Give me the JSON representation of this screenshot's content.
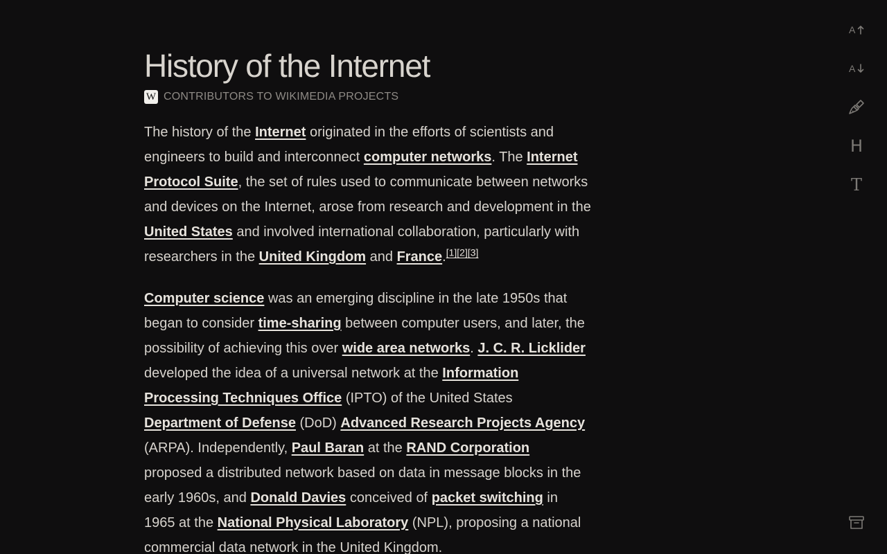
{
  "article": {
    "title": "History of the Internet",
    "source_logo": "W",
    "byline": "CONTRIBUTORS TO WIKIMEDIA PROJECTS",
    "p1": [
      {
        "t": "The history of the "
      },
      {
        "t": "Internet",
        "link": true
      },
      {
        "t": " originated in the efforts of scientists and engineers to build and interconnect "
      },
      {
        "t": "computer networks",
        "link": true
      },
      {
        "t": ". The "
      },
      {
        "t": "Internet Protocol Suite",
        "link": true
      },
      {
        "t": ", the set of rules used to communicate between networks and devices on the Internet, arose from research and development in the "
      },
      {
        "t": "United States",
        "link": true
      },
      {
        "t": " and involved international collaboration, particularly with researchers in the "
      },
      {
        "t": "United Kingdom",
        "link": true
      },
      {
        "t": " and "
      },
      {
        "t": "France",
        "link": true
      },
      {
        "t": "."
      },
      {
        "t": "[1]",
        "link": true,
        "sup": true
      },
      {
        "t": "[2]",
        "link": true,
        "sup": true
      },
      {
        "t": "[3]",
        "link": true,
        "sup": true
      }
    ],
    "p2": [
      {
        "t": "Computer science",
        "link": true
      },
      {
        "t": " was an emerging discipline in the late 1950s that began to consider "
      },
      {
        "t": "time-sharing",
        "link": true
      },
      {
        "t": " between computer users, and later, the possibility of achieving this over "
      },
      {
        "t": "wide area networks",
        "link": true
      },
      {
        "t": ". "
      },
      {
        "t": "J. C. R. Licklider",
        "link": true
      },
      {
        "t": " developed the idea of a universal network at the "
      },
      {
        "t": "Information Processing Techniques Office",
        "link": true
      },
      {
        "t": " (IPTO) of the United States "
      },
      {
        "t": "Department of Defense",
        "link": true
      },
      {
        "t": " (DoD) "
      },
      {
        "t": "Advanced Research Projects Agency",
        "link": true
      },
      {
        "t": " (ARPA). Independently, "
      },
      {
        "t": "Paul Baran",
        "link": true
      },
      {
        "t": " at the "
      },
      {
        "t": "RAND Corporation",
        "link": true
      },
      {
        "t": " proposed a distributed network based on data in message blocks in the early 1960s, and "
      },
      {
        "t": "Donald Davies",
        "link": true
      },
      {
        "t": " conceived of "
      },
      {
        "t": "packet switching",
        "link": true
      },
      {
        "t": " in 1965 at the "
      },
      {
        "t": "National Physical Laboratory",
        "link": true
      },
      {
        "t": " (NPL), proposing a national commercial data network in the United Kingdom."
      }
    ]
  },
  "toolbar": {
    "increase_font_label": "A",
    "decrease_font_label": "A",
    "heading_label": "H",
    "text_label": "T",
    "icons": [
      "increase-font-icon",
      "decrease-font-icon",
      "paintbrush-icon",
      "heading-icon",
      "text-icon",
      "archive-icon"
    ]
  }
}
